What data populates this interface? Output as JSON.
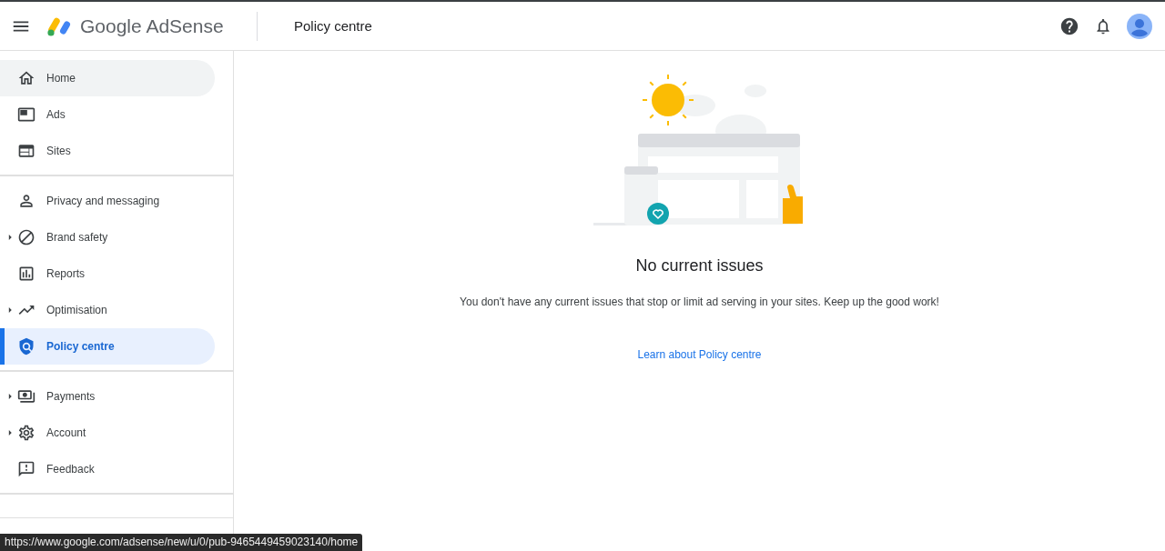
{
  "header": {
    "product": "Google AdSense",
    "page_title": "Policy centre"
  },
  "sidebar": {
    "groups": [
      {
        "items": [
          {
            "label": "Home",
            "selected": false,
            "hovered": true,
            "expandable": false
          },
          {
            "label": "Ads",
            "selected": false,
            "hovered": false,
            "expandable": false
          },
          {
            "label": "Sites",
            "selected": false,
            "hovered": false,
            "expandable": false
          }
        ]
      },
      {
        "items": [
          {
            "label": "Privacy and messaging",
            "selected": false,
            "hovered": false,
            "expandable": false
          },
          {
            "label": "Brand safety",
            "selected": false,
            "hovered": false,
            "expandable": true
          },
          {
            "label": "Reports",
            "selected": false,
            "hovered": false,
            "expandable": false
          },
          {
            "label": "Optimisation",
            "selected": false,
            "hovered": false,
            "expandable": true
          },
          {
            "label": "Policy centre",
            "selected": true,
            "hovered": false,
            "expandable": false
          }
        ]
      },
      {
        "items": [
          {
            "label": "Payments",
            "selected": false,
            "hovered": false,
            "expandable": true
          },
          {
            "label": "Account",
            "selected": false,
            "hovered": false,
            "expandable": true
          },
          {
            "label": "Feedback",
            "selected": false,
            "hovered": false,
            "expandable": false
          }
        ]
      }
    ]
  },
  "main": {
    "heading": "No current issues",
    "message": "You don't have any current issues that stop or limit ad serving in your sites. Keep up the good work!",
    "link": "Learn about Policy centre"
  },
  "status_url": "https://www.google.com/adsense/new/u/0/pub-9465449459023140/home"
}
